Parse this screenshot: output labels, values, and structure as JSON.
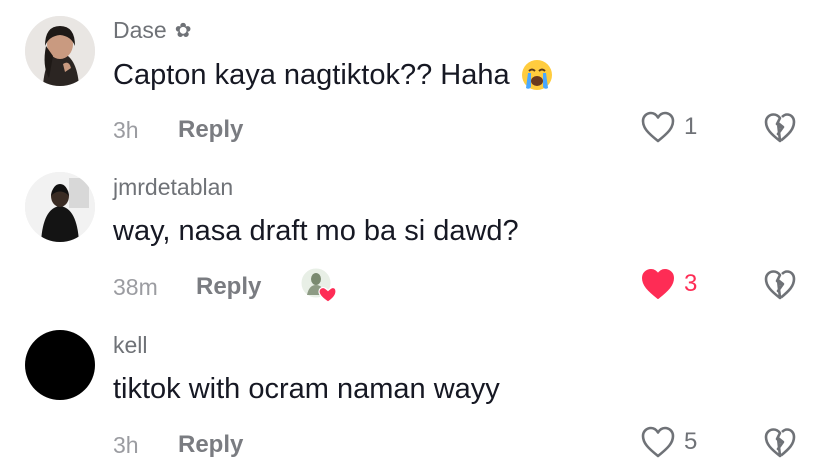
{
  "comments": [
    {
      "username": "Dase",
      "text": "Capton kaya nagtiktok?? Haha",
      "time": "3h",
      "reply_label": "Reply",
      "like_count": "1",
      "liked": false,
      "icons": {
        "badge": "flower-icon",
        "emoji": "loudly-crying-face-emoji",
        "like": "heart-outline-icon",
        "dislike": "broken-heart-icon"
      }
    },
    {
      "username": "jmrdetablan",
      "text": "way, nasa draft mo ba si dawd?",
      "time": "38m",
      "reply_label": "Reply",
      "like_count": "3",
      "liked": true,
      "creator_liked": true,
      "icons": {
        "like": "heart-filled-icon",
        "dislike": "broken-heart-icon",
        "creator_like": "creator-liked-avatar-icon"
      }
    },
    {
      "username": "kell",
      "text": "tiktok with ocram naman wayy",
      "time": "3h",
      "reply_label": "Reply",
      "like_count": "5",
      "liked": false,
      "icons": {
        "like": "heart-outline-icon",
        "dislike": "broken-heart-icon"
      }
    }
  ],
  "colors": {
    "accent": "#fe2c55",
    "muted": "#6f7277",
    "text": "#161823"
  }
}
